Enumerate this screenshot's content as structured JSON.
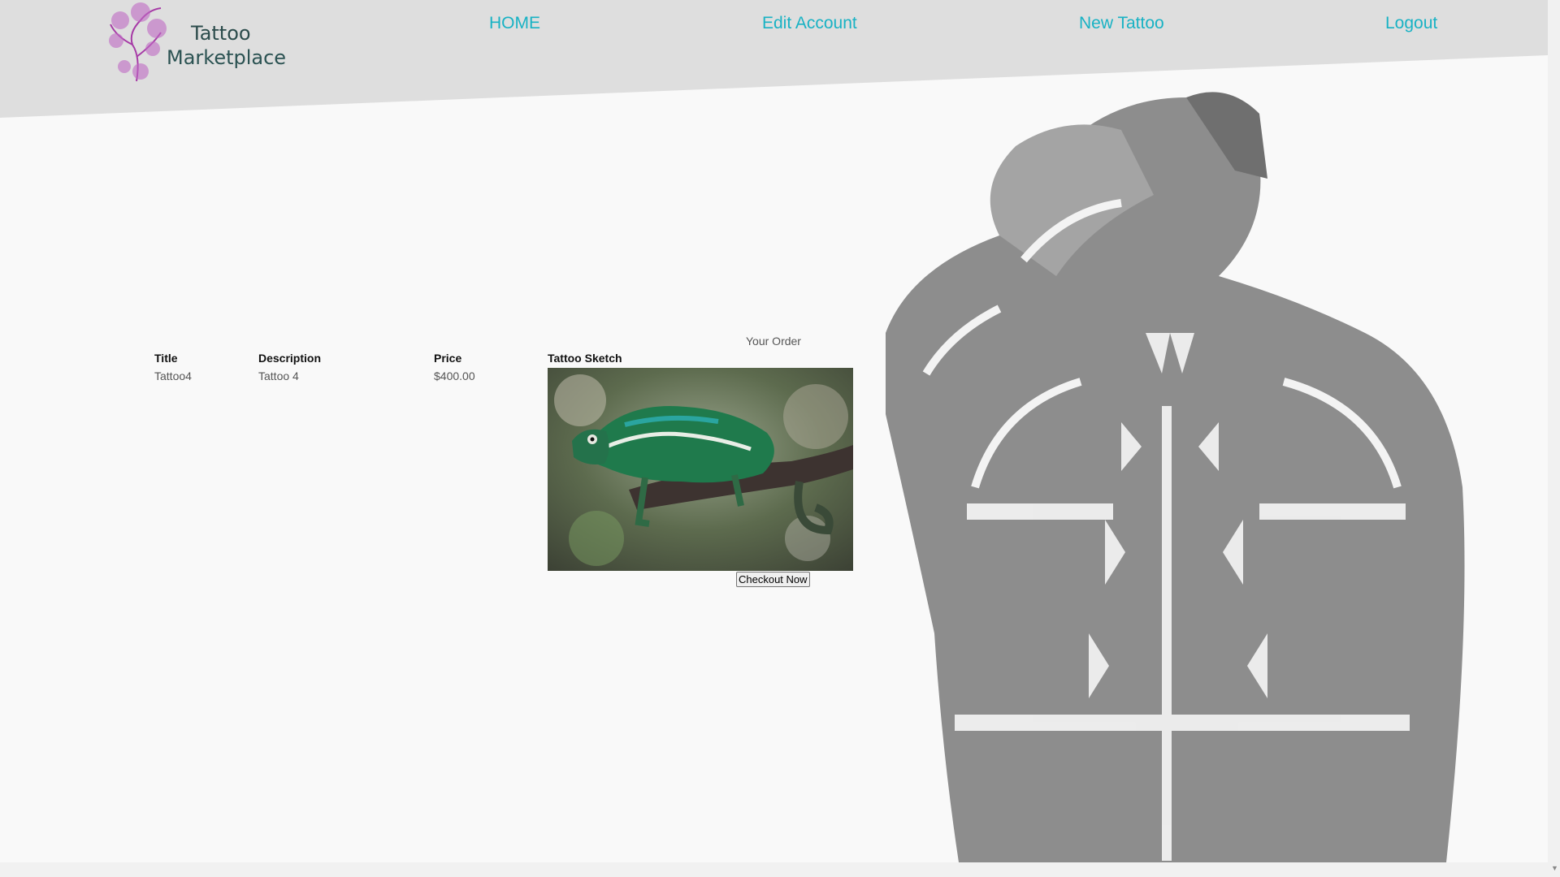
{
  "brand": {
    "line1": "Tattoo",
    "line2": "Marketplace"
  },
  "nav": {
    "home": "HOME",
    "edit_account": "Edit Account",
    "new_tattoo": "New Tattoo",
    "logout": "Logout"
  },
  "order": {
    "caption": "Your Order",
    "columns": [
      "Title",
      "Description",
      "Price",
      "Tattoo Sketch"
    ],
    "row": {
      "title": "Tattoo4",
      "description": "Tattoo 4",
      "price": "$400.00"
    },
    "checkout_label": "Checkout Now"
  },
  "colors": {
    "nav_link": "#18b2c4",
    "header_band": "#dedede"
  },
  "icons": {
    "scroll_down": "chevron-down-icon"
  }
}
